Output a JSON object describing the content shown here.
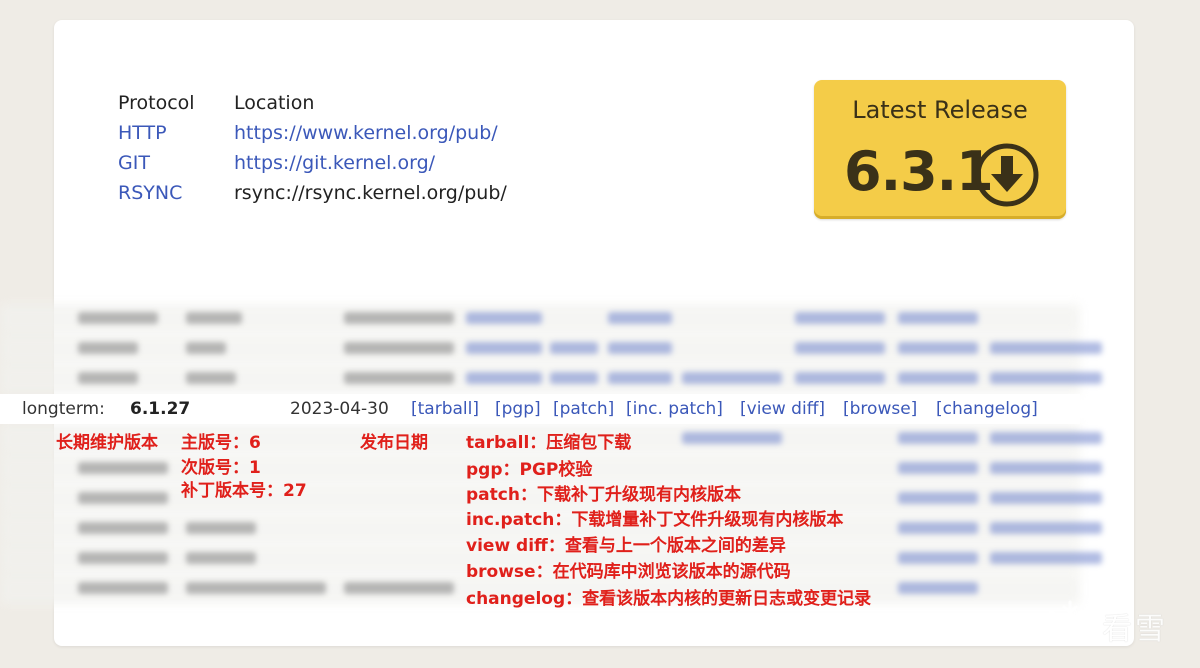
{
  "protocols": {
    "header": {
      "protocol": "Protocol",
      "location": "Location"
    },
    "rows": [
      {
        "protocol": "HTTP",
        "location": "https://www.kernel.org/pub/"
      },
      {
        "protocol": "GIT",
        "location": "https://git.kernel.org/"
      },
      {
        "protocol": "RSYNC",
        "location": "rsync://rsync.kernel.org/pub/"
      }
    ]
  },
  "latest_release": {
    "title": "Latest Release",
    "version": "6.3.1",
    "icon": "download-circle-icon"
  },
  "releases": {
    "highlighted": {
      "kind": "longterm:",
      "version": "6.1.27",
      "date": "2023-04-30",
      "links": {
        "tarball": "[tarball]",
        "pgp": "[pgp]",
        "patch": "[patch]",
        "inc_patch": "[inc. patch]",
        "view_diff": "[view diff]",
        "browse": "[browse]",
        "changelog": "[changelog]"
      }
    }
  },
  "annotations": {
    "kind": "长期维护版本",
    "major": "主版号：6",
    "minor": "次版号：1",
    "patchlevel": "补丁版本号：27",
    "date": "发布日期",
    "tarball": "tarball：压缩包下载",
    "pgp": "pgp：PGP校验",
    "patch": "patch：下载补丁升级现有内核版本",
    "inc_patch": "inc.patch：下载增量补丁文件升级现有内核版本",
    "view_diff": "view diff：查看与上一个版本之间的差异",
    "browse": "browse：在代码库中浏览该版本的源代码",
    "changelog": "changelog：查看该版本内核的更新日志或变更记录"
  },
  "watermark": {
    "text": "看雪"
  },
  "colors": {
    "link": "#3b58b9",
    "annotation": "#e0201b",
    "button": "#f4cc48"
  }
}
